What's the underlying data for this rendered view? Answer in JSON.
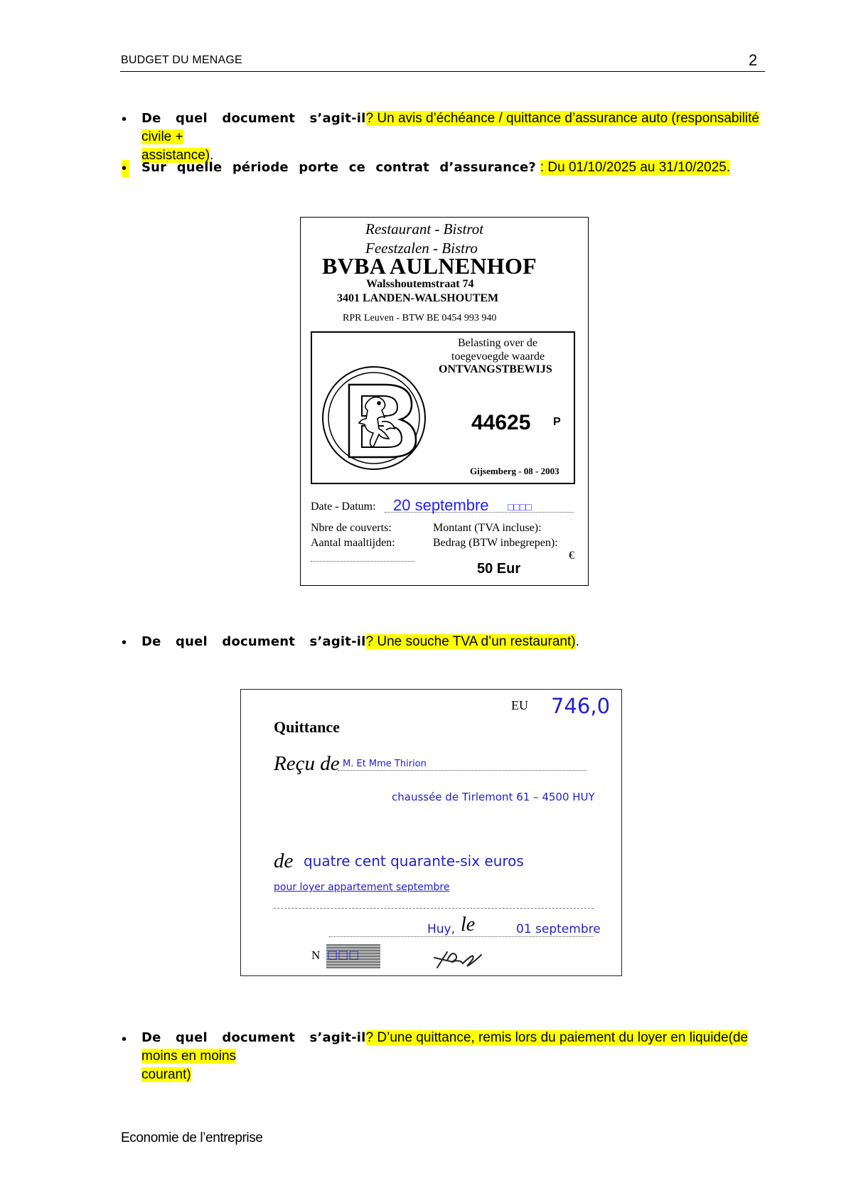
{
  "header": {
    "title": "BUDGET DU MENAGE",
    "page_number": "2"
  },
  "questions": [
    {
      "label": "De quel document s’agit-il",
      "qmark": "?",
      "answer_line1": "  Un avis d’échéance / quittance d’assurance auto (responsabilité civile +",
      "answer_line2": "assistance)",
      "suffix": "."
    },
    {
      "label": "Sur quelle période porte ce contrat d’assurance?",
      "answer": " : Du 01/10/2025 au 31/10/2025."
    },
    {
      "label": "De quel document s’agit-il",
      "qmark": "?",
      "answer": "  Une souche TVA d’un restaurant)",
      "suffix": "."
    },
    {
      "label": "De quel document s’agit-il",
      "qmark": "?",
      "answer_line1": "  D’une quittance, remis lors du paiement du  loyer en liquide(de moins en moins",
      "answer_line2": "courant)"
    }
  ],
  "bullet_glyph": "•",
  "receipt1": {
    "line1": "Restaurant   -   Bistrot",
    "line2": "Feestzalen   -   Bistro",
    "company": "BVBA AULNENHOF",
    "street": "Walsshoutemstraat 74",
    "city": "3401 LANDEN-WALSHOUTEM",
    "rpr": "RPR Leuven - BTW BE 0454 993 940",
    "tax1": "Belasting over de",
    "tax2": "toegevoegde waarde",
    "doc_title": "ONTVANGSTBEWIJS",
    "number": "44625",
    "number_suffix": "P",
    "printer": "Gijsemberg - 08 - 2003",
    "date_label": "Date - Datum:",
    "date_value": "20  septembre",
    "date_boxes": "□□□□",
    "covers_fr": "Nbre de couverts:",
    "covers_nl": "Aantal maaltijden:",
    "amount_fr": "Montant (TVA incluse):",
    "amount_nl": "Bedrag (BTW inbegrepen):",
    "euro_symbol": "€",
    "amount_value": "50 Eur"
  },
  "receipt2": {
    "currency_label": "EU",
    "amount": "746,0",
    "title": "Quittance",
    "received_from_label": "Reçu de",
    "received_from": "M.  Et  Mme  Thirion",
    "address": "chaussée  de  Tirlemont  61  –  4500  HUY",
    "de_label": "de",
    "amount_words": "quatre  cent  quarante-six  euros",
    "purpose": "pour  loyer  appartement  septembre",
    "place": "Huy,",
    "le_label": "le",
    "date": "01  septembre",
    "n_label": "N",
    "n_boxes": "□□□"
  },
  "footer": {
    "text": "Economie de l’entreprise"
  },
  "colors": {
    "highlight": "#ffff00",
    "handwriting_blue": "#1f1fff"
  }
}
